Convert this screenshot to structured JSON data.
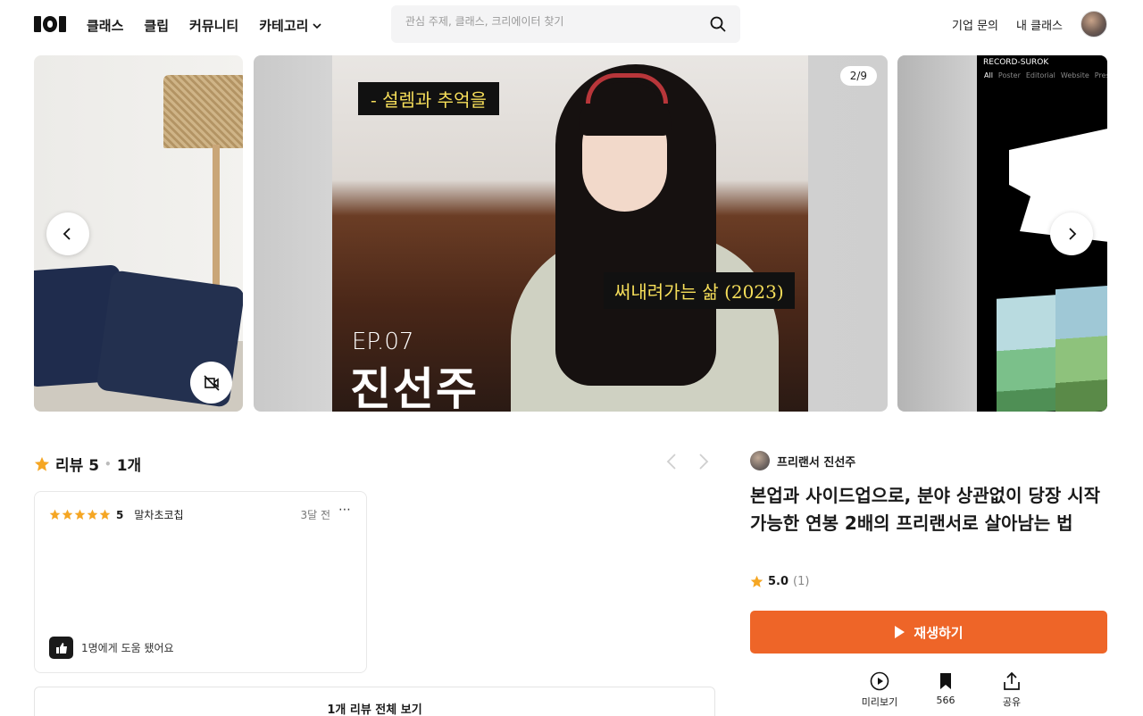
{
  "header": {
    "nav": [
      "클래스",
      "클립",
      "커뮤니티",
      "카테고리"
    ],
    "search_placeholder": "관심 주제, 클래스, 크리에이터 찾기",
    "corporate": "기업 문의",
    "my_class": "내 클래스"
  },
  "carousel": {
    "counter": "2/9",
    "caption_top": "- 설렘과 추억을",
    "caption_bottom": "써내려가는 삶 (2023)",
    "episode": "EP.07",
    "name": "진선주",
    "poster_brand": "RECORD-SUROK",
    "poster_menu": [
      "All",
      "Poster",
      "Editorial",
      "Website",
      "Press"
    ]
  },
  "reviews": {
    "label": "리뷰 5",
    "count": "1개",
    "card": {
      "rating": "5",
      "author": "말차초코칩",
      "time": "3달 전",
      "helpful": "1명에게 도움 됐어요"
    },
    "view_all": "1개 리뷰 전체 보기"
  },
  "product": {
    "creator": "프리랜서 진선주",
    "title": "본업과 사이드업으로, 분야 상관없이 당장 시작 가능한 연봉 2배의 프리랜서로 살아남는 법",
    "rating": "5.0",
    "rating_count": "(1)",
    "play_label": "재생하기",
    "actions": {
      "preview": "미리보기",
      "bookmark_count": "566",
      "share": "공유"
    }
  },
  "colors": {
    "accent": "#ee6528",
    "star": "#f5a623"
  }
}
